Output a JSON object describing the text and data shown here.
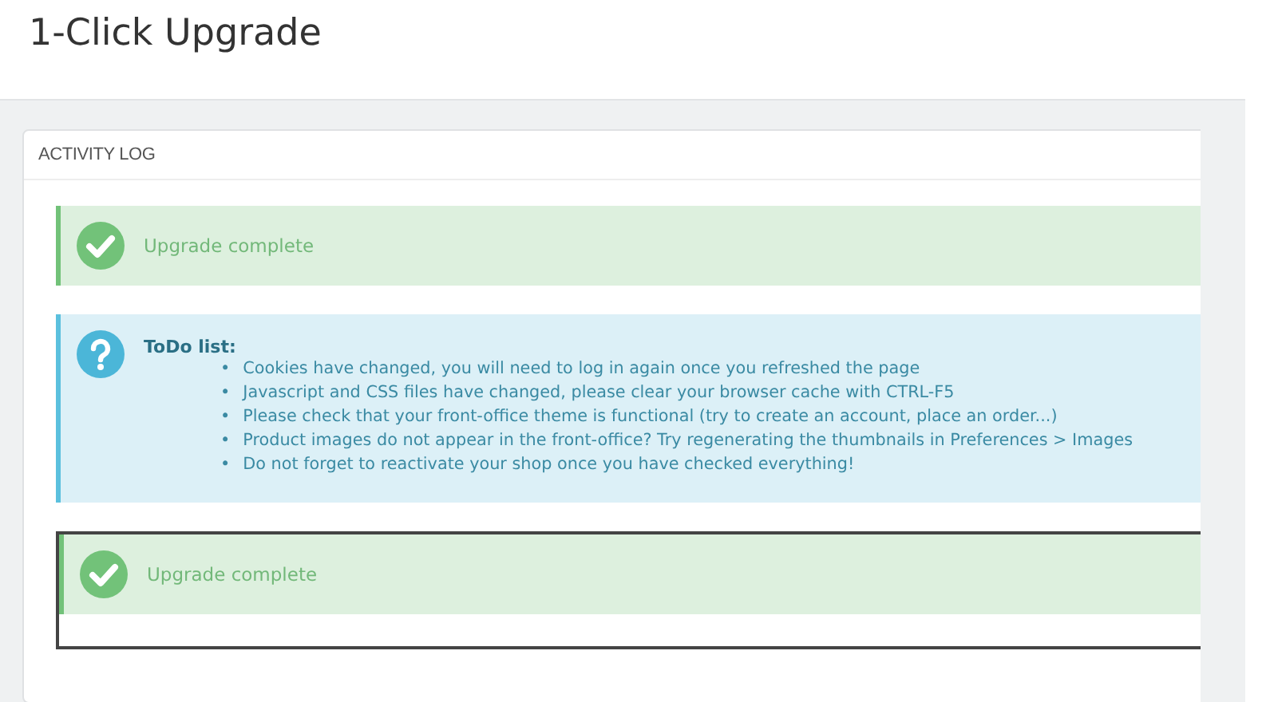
{
  "page_title": "1-Click Upgrade",
  "panel": {
    "heading": "ACTIVITY LOG",
    "entries": [
      {
        "kind": "success",
        "framed": false,
        "text": "Upgrade complete"
      },
      {
        "kind": "info",
        "framed": false,
        "title": "ToDo list:",
        "bullet": "•",
        "items": [
          "Cookies have changed, you will need to log in again once you refreshed the page",
          "Javascript and CSS files have changed, please clear your browser cache with CTRL-F5",
          "Please check that your front-office theme is functional (try to create an account, place an order...)",
          "Product images do not appear in the front-office? Try regenerating the thumbnails in Preferences > Images",
          "Do not forget to reactivate your shop once you have checked everything!"
        ]
      },
      {
        "kind": "success",
        "framed": true,
        "text": "Upgrade complete"
      }
    ]
  }
}
